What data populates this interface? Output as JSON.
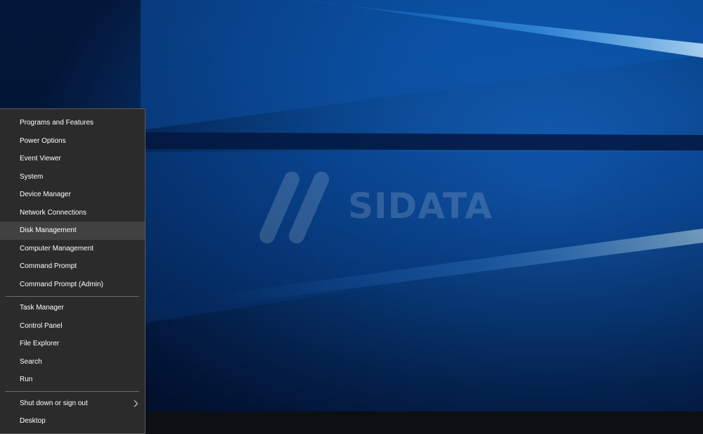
{
  "context_menu": {
    "groups": [
      {
        "items": [
          {
            "label": "Programs and Features"
          },
          {
            "label": "Power Options"
          },
          {
            "label": "Event Viewer"
          },
          {
            "label": "System"
          },
          {
            "label": "Device Manager"
          },
          {
            "label": "Network Connections"
          },
          {
            "label": "Disk Management",
            "hovered": true
          },
          {
            "label": "Computer Management"
          },
          {
            "label": "Command Prompt"
          },
          {
            "label": "Command Prompt (Admin)"
          }
        ]
      },
      {
        "items": [
          {
            "label": "Task Manager"
          },
          {
            "label": "Control Panel"
          },
          {
            "label": "File Explorer"
          },
          {
            "label": "Search"
          },
          {
            "label": "Run"
          }
        ]
      },
      {
        "items": [
          {
            "label": "Shut down or sign out",
            "submenu": true
          },
          {
            "label": "Desktop"
          }
        ]
      }
    ]
  },
  "watermark": {
    "text": "SIDATA"
  },
  "colors": {
    "menu_background": "#2b2b2b",
    "menu_hover": "#414141",
    "menu_text": "#ffffff",
    "wallpaper_blue": "#0a64c8",
    "taskbar": "#0c0f14"
  },
  "icons": {
    "submenu_indicator": "chevron-right-icon"
  }
}
